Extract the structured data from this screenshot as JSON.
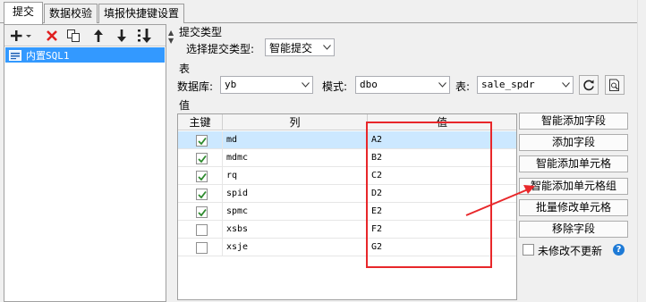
{
  "tabs": [
    {
      "label": "提交"
    },
    {
      "label": "数据校验"
    },
    {
      "label": "填报快捷键设置"
    }
  ],
  "toolbar": {
    "icons": [
      "add-icon",
      "delete-icon",
      "copy-icon",
      "move-up-icon",
      "move-down-icon",
      "sort-icon"
    ]
  },
  "tree": {
    "items": [
      {
        "label": "内置SQL1"
      }
    ]
  },
  "submit_type": {
    "section_label": "提交类型",
    "select_label": "选择提交类型:",
    "value": "智能提交"
  },
  "table_section": {
    "section_label": "表",
    "db_label": "数据库:",
    "db_value": "yb",
    "schema_label": "模式:",
    "schema_value": "dbo",
    "table_label": "表:",
    "table_value": "sale_spdr"
  },
  "value_section": {
    "section_label": "值",
    "headers": {
      "key": "主键",
      "column": "列",
      "value": "值"
    },
    "rows": [
      {
        "checked": true,
        "column": "md",
        "value": "A2"
      },
      {
        "checked": true,
        "column": "mdmc",
        "value": "B2"
      },
      {
        "checked": true,
        "column": "rq",
        "value": "C2"
      },
      {
        "checked": true,
        "column": "spid",
        "value": "D2"
      },
      {
        "checked": true,
        "column": "spmc",
        "value": "E2"
      },
      {
        "checked": false,
        "column": "xsbs",
        "value": "F2"
      },
      {
        "checked": false,
        "column": "xsje",
        "value": "G2"
      }
    ]
  },
  "actions": {
    "smart_add_field": "智能添加字段",
    "add_field": "添加字段",
    "smart_add_cell": "智能添加单元格",
    "smart_add_cell_group": "智能添加单元格组",
    "batch_edit_cell": "批量修改单元格",
    "remove_field": "移除字段",
    "no_update_label": "未修改不更新",
    "no_update_checked": false
  },
  "colors": {
    "selection": "#3399ff",
    "row_selected": "#cce8ff",
    "annotation_red": "#e8272a",
    "check_green": "#2d8a2d",
    "help_blue": "#1e7ad6"
  }
}
